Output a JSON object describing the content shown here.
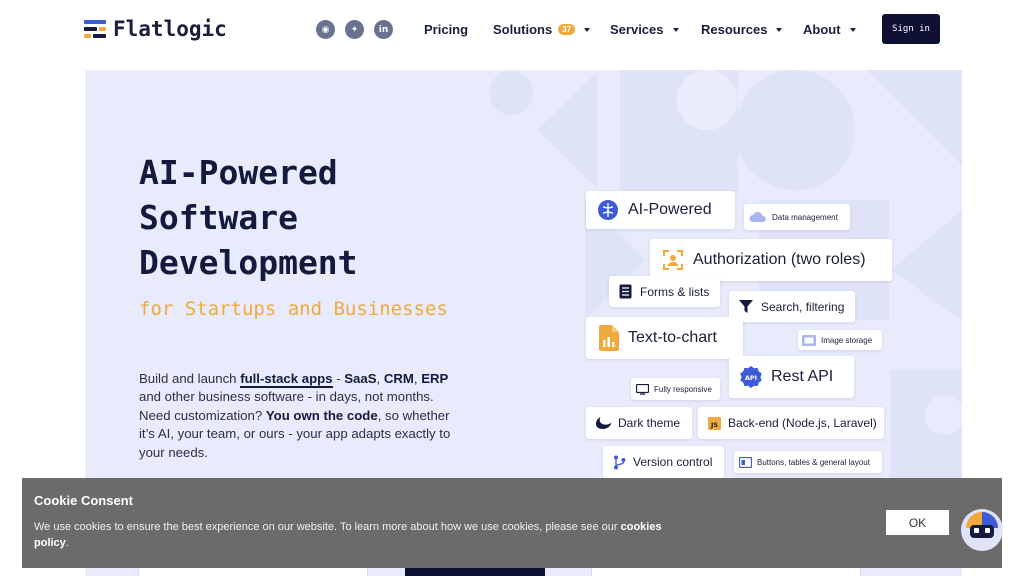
{
  "brand": {
    "name": "Flatlogic",
    "colors": {
      "navy": "#141a3d",
      "orange": "#f2a93b",
      "blue": "#3d5bd9",
      "hero_bg": "#e8ebfb"
    }
  },
  "socials": [
    {
      "name": "discord-icon",
      "glyph": "◉"
    },
    {
      "name": "twitter-icon",
      "glyph": "✦"
    },
    {
      "name": "linkedin-icon",
      "glyph": "in"
    }
  ],
  "nav": {
    "pricing": "Pricing",
    "solutions": "Solutions",
    "solutions_badge": "37",
    "services": "Services",
    "resources": "Resources",
    "about": "About",
    "signin": "Sign in"
  },
  "hero": {
    "title_line1": "AI-Powered",
    "title_line2": "Software",
    "title_line3": "Development",
    "subtitle": "for Startups and Businesses",
    "desc": {
      "p1": "Build and launch ",
      "b1": "full-stack apps",
      "p2": " - ",
      "b2": "SaaS",
      "p3": ", ",
      "b3": "CRM",
      "p4": ", ",
      "b4": "ERP",
      "p5": " and other business software - in days, not months. Need customization? ",
      "b5": "You own the code",
      "p6": ", so whether it’s AI, your team, or ours - your app adapts exactly to your needs."
    }
  },
  "features": {
    "ai_powered": "AI-Powered",
    "data_management": "Data management",
    "authorization": "Authorization (two roles)",
    "forms_lists": "Forms & lists",
    "search_filtering": "Search, filtering",
    "text_to_chart": "Text-to-chart",
    "image_storage": "Image storage",
    "rest_api": "Rest API",
    "api_badge": "API",
    "fully_responsive": "Fully responsive",
    "dark_theme": "Dark theme",
    "backend": "Back-end (Node.js, Laravel)",
    "js_badge": "JS",
    "version_control": "Version control",
    "buttons_tables": "Buttons, tables & general layout"
  },
  "cookie": {
    "title": "Cookie Consent",
    "text": "We use cookies to ensure the best experience on our website. To learn more about how we use cookies, please see our ",
    "link": "cookies policy",
    "end": ".",
    "ok": "OK"
  }
}
